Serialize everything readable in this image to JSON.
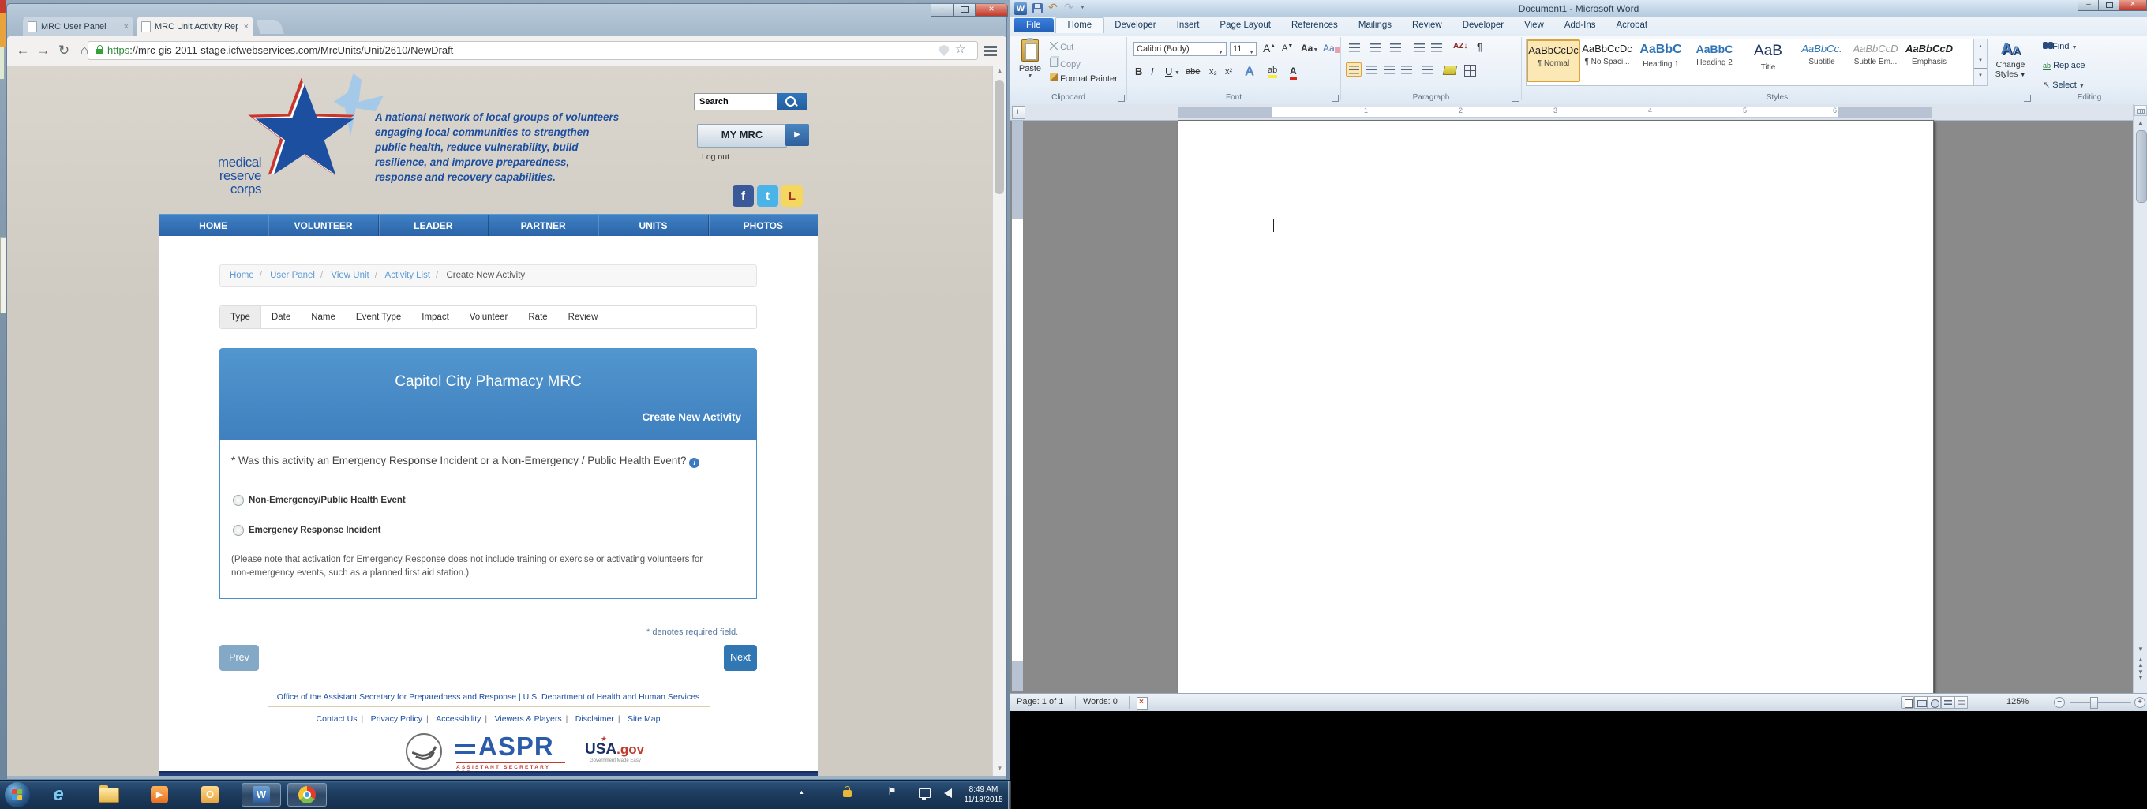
{
  "icons": {
    "back": "←",
    "forward": "→",
    "reload": "↻",
    "home": "⌂",
    "star": "☆",
    "close": "×",
    "minimize": "–",
    "play": "▶",
    "caret_up": "▲",
    "caret_down": "▼",
    "pilcrow": "¶",
    "select": "↖",
    "undo": "↶",
    "redo": "↷",
    "info": "i",
    "sort": "AZ↓",
    "case": "Aa",
    "grow": "A",
    "shrink": "A",
    "effects": "A",
    "highlight": "ab",
    "fontcolor": "A",
    "strike": "abe",
    "sub": "x₂",
    "sup": "x²",
    "bold": "B",
    "italic": "I",
    "underline": "U",
    "flag": "⚑",
    "ie": "e",
    "outlook": "O",
    "word_w": "W"
  },
  "browser": {
    "tab1": "MRC User Panel",
    "tab2": "MRC Unit Activity Reporti",
    "url_scheme": "https",
    "url_rest": "://mrc-gis-2011-stage.icfwebservices.com/MrcUnits/Unit/2610/NewDraft"
  },
  "mrc": {
    "logo": [
      "medical",
      "reserve",
      "corps"
    ],
    "tagline": [
      "A national network of local groups of volunteers",
      "engaging local communities to strengthen",
      "public health, reduce vulnerability, build",
      "resilience, and improve preparedness,",
      "response and recovery capabilities."
    ],
    "search": "Search",
    "my_mrc": "MY MRC",
    "logout": "Log out",
    "social": [
      "f",
      "t",
      "L"
    ],
    "nav": [
      "HOME",
      "VOLUNTEER",
      "LEADER",
      "PARTNER",
      "UNITS",
      "PHOTOS"
    ],
    "breadcrumb": [
      "Home",
      "User Panel",
      "View Unit",
      "Activity List",
      "Create New Activity"
    ],
    "breadcrumb_sep": "/",
    "steps": [
      "Type",
      "Date",
      "Name",
      "Event Type",
      "Impact",
      "Volunteer",
      "Rate",
      "Review"
    ],
    "unit_title": "Capitol City Pharmacy MRC",
    "panel_subtitle": "Create New Activity",
    "question": "* Was this activity an Emergency Response Incident or a Non-Emergency / Public Health Event?",
    "option1": "Non-Emergency/Public Health Event",
    "option2": "Emergency Response Incident",
    "note": "(Please note that activation for Emergency Response does not include training or exercise or activating volunteers for non-emergency events, such as a planned first aid station.)",
    "required": "* denotes required field.",
    "prev": "Prev",
    "next": "Next",
    "footer_line1": "Office of the Assistant Secretary for Preparedness and Response | U.S. Department of Health and Human Services",
    "footer_links": [
      "Contact Us",
      "Privacy Policy",
      "Accessibility",
      "Viewers & Players",
      "Disclaimer",
      "Site Map"
    ],
    "footer_sep": "|",
    "aspr": "ASPR",
    "aspr_sub": "ASSISTANT SECRETARY FOR",
    "usa_main": "USA",
    "usa_gov": ".gov",
    "usa_tag": "Government Made Easy"
  },
  "word": {
    "title": "Document1 - Microsoft Word",
    "tabs": [
      "File",
      "Home",
      "Developer",
      "Insert",
      "Page Layout",
      "References",
      "Mailings",
      "Review",
      "Developer",
      "View",
      "Add-Ins",
      "Acrobat"
    ],
    "groups": {
      "clipboard": "Clipboard",
      "font": "Font",
      "paragraph": "Paragraph",
      "styles": "Styles",
      "editing": "Editing"
    },
    "clipboard": {
      "paste": "Paste",
      "cut": "Cut",
      "copy": "Copy",
      "painter": "Format Painter"
    },
    "font": {
      "name": "Calibri (Body)",
      "size": "11"
    },
    "styles": {
      "entries": [
        {
          "preview": "AaBbCcDc",
          "label": "¶ Normal"
        },
        {
          "preview": "AaBbCcDc",
          "label": "¶ No Spaci..."
        },
        {
          "preview": "AaBbC",
          "label": "Heading 1"
        },
        {
          "preview": "AaBbC",
          "label": "Heading 2"
        },
        {
          "preview": "AaB",
          "label": "Title"
        },
        {
          "preview": "AaBbCc.",
          "label": "Subtitle"
        },
        {
          "preview": "AaBbCcD",
          "label": "Subtle Em..."
        },
        {
          "preview": "AaBbCcD",
          "label": "Emphasis"
        }
      ],
      "change1": "Change",
      "change2": "Styles"
    },
    "editing": {
      "find": "Find",
      "replace": "Replace",
      "select": "Select"
    },
    "ruler": [
      "1",
      "2",
      "3",
      "4",
      "5",
      "6"
    ],
    "status": {
      "page": "Page: 1 of 1",
      "words": "Words: 0",
      "zoom": "125%"
    }
  },
  "taskbar": {
    "time": "8:49 AM",
    "date": "11/18/2015"
  }
}
